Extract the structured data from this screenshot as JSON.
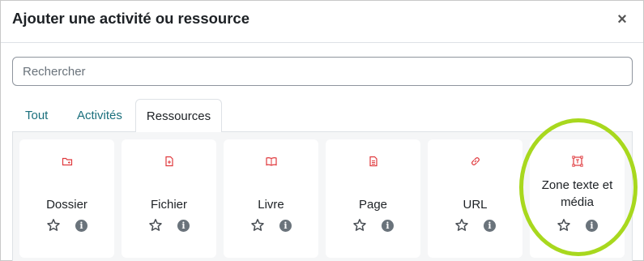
{
  "modal": {
    "title": "Ajouter une activité ou ressource",
    "close_symbol": "×"
  },
  "search": {
    "placeholder": "Rechercher",
    "value": ""
  },
  "tabs": [
    {
      "label": "Tout",
      "active": false
    },
    {
      "label": "Activités",
      "active": false
    },
    {
      "label": "Ressources",
      "active": true
    }
  ],
  "resources": [
    {
      "label": "Dossier",
      "icon": "folder-icon"
    },
    {
      "label": "Fichier",
      "icon": "file-icon"
    },
    {
      "label": "Livre",
      "icon": "book-icon"
    },
    {
      "label": "Page",
      "icon": "page-icon"
    },
    {
      "label": "URL",
      "icon": "link-icon"
    },
    {
      "label": "Zone texte et média",
      "icon": "text-media-icon"
    }
  ],
  "colors": {
    "accent_tab": "#1a6f7c",
    "resource_icon": "#e03a3e",
    "highlight": "#a8d81e"
  }
}
